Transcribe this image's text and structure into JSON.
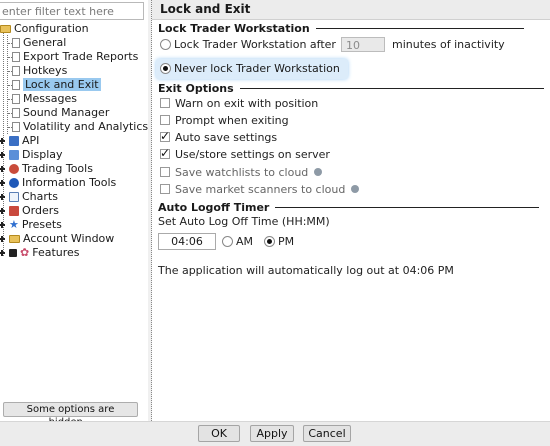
{
  "filter": {
    "placeholder": "enter filter text here"
  },
  "tree": {
    "root": "Configuration",
    "items": [
      "General",
      "Export Trade Reports",
      "Hotkeys",
      "Lock and Exit",
      "Messages",
      "Sound Manager",
      "Volatility and Analytics"
    ],
    "groups": [
      "API",
      "Display",
      "Trading Tools",
      "Information Tools",
      "Charts",
      "Orders",
      "Presets",
      "Account Window",
      "Features"
    ],
    "selected": "Lock and Exit"
  },
  "hidden_button": "Some options are hidden...",
  "panel": {
    "title": "Lock and Exit"
  },
  "lock": {
    "heading": "Lock Trader Workstation",
    "after_label": "Lock Trader Workstation after",
    "minutes_value": "10",
    "minutes_suffix": "minutes of inactivity",
    "never_label": "Never lock Trader Workstation",
    "selected": "never"
  },
  "exit": {
    "heading": "Exit Options",
    "options": [
      {
        "label": "Warn on exit with position",
        "checked": false
      },
      {
        "label": "Prompt when exiting",
        "checked": false
      },
      {
        "label": "Auto save settings",
        "checked": true
      },
      {
        "label": "Use/store settings on server",
        "checked": true
      },
      {
        "label": "Save watchlists to cloud",
        "checked": false
      },
      {
        "label": "Save market scanners to cloud",
        "checked": false
      }
    ]
  },
  "logoff": {
    "heading": "Auto Logoff Timer",
    "set_label": "Set Auto Log Off Time (HH:MM)",
    "time": "04:06",
    "am": "AM",
    "pm": "PM",
    "selected": "PM",
    "message": "The application will automatically log out at 04:06 PM"
  },
  "buttons": {
    "ok": "OK",
    "apply": "Apply",
    "cancel": "Cancel"
  },
  "colors": {
    "selection": "#99c9ef",
    "folder": "#e8c15a"
  }
}
